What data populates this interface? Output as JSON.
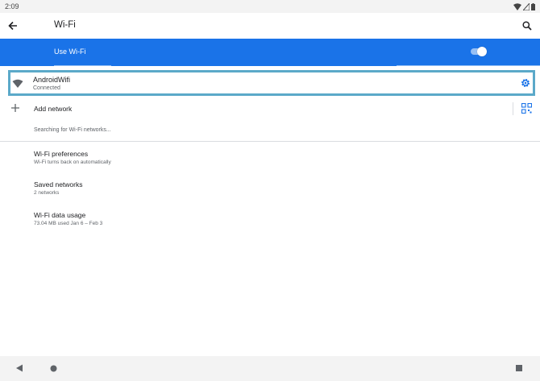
{
  "status_bar": {
    "time": "2:09"
  },
  "app_bar": {
    "title": "Wi-Fi"
  },
  "toggle": {
    "label": "Use Wi-Fi",
    "checked": true
  },
  "network": {
    "name": "AndroidWifi",
    "status": "Connected"
  },
  "add_network": {
    "label": "Add network"
  },
  "searching": {
    "text": "Searching for Wi-Fi networks..."
  },
  "prefs": [
    {
      "title": "Wi-Fi preferences",
      "subtitle": "Wi-Fi turns back on automatically"
    },
    {
      "title": "Saved networks",
      "subtitle": "2 networks"
    },
    {
      "title": "Wi-Fi data usage",
      "subtitle": "73.04 MB used Jan 6 – Feb 3"
    }
  ],
  "colors": {
    "accent": "#1a73e8",
    "highlight_border": "#5ba9c9",
    "status_bar": "#f3f3f3"
  },
  "icons": [
    "wifi-status-icon",
    "signal-icon",
    "battery-icon",
    "back-arrow-icon",
    "search-icon",
    "wifi-icon",
    "gear-icon",
    "plus-icon",
    "qr-code-icon",
    "nav-back-icon",
    "nav-home-icon",
    "nav-recents-icon"
  ]
}
